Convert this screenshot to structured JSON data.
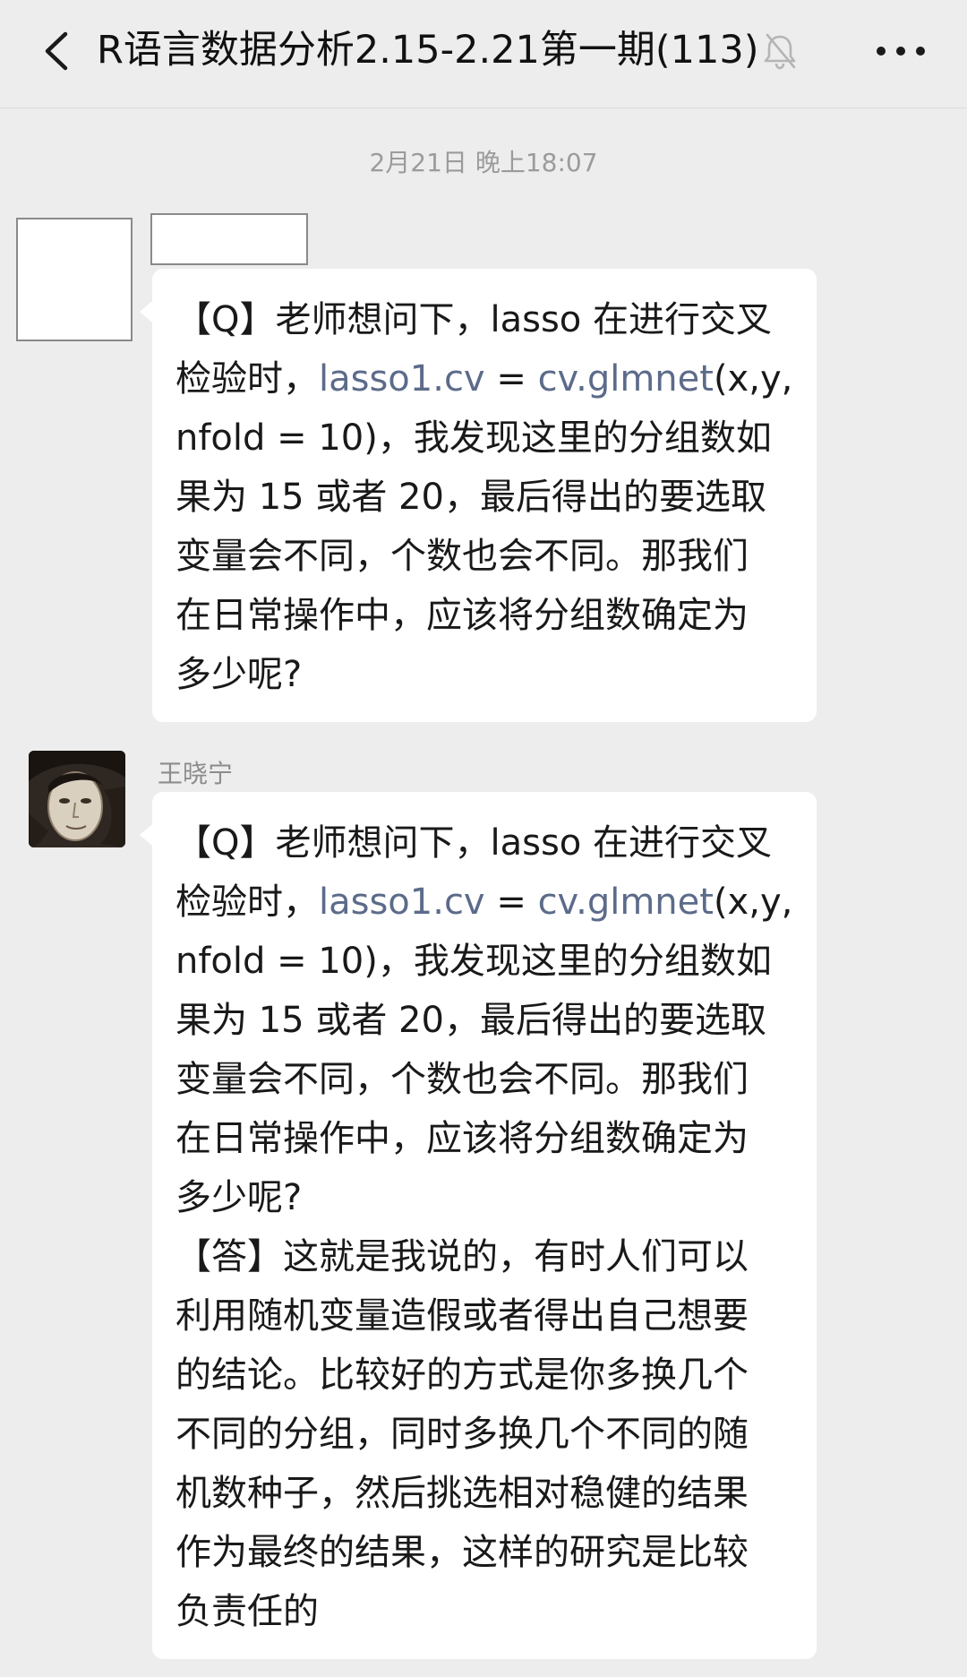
{
  "header": {
    "title": "R语言数据分析2.15-2.21第一期(113)",
    "back_icon": "chevron-left-icon",
    "mute_icon": "bell-off-icon",
    "more_icon": "more-dots-icon"
  },
  "timestamp": "2月21日 晚上18:07",
  "messages": [
    {
      "sender": "",
      "lines": [
        [
          "【Q】老师想问下，lasso 在进行交叉"
        ],
        [
          "检验时，",
          "lasso1.cv",
          " = ",
          "cv.glmnet",
          "(x,y,"
        ],
        [
          "nfold = 10)，我发现这里的分组数如"
        ],
        [
          "果为 15 或者 20，最后得出的要选取"
        ],
        [
          "变量会不同，个数也会不同。那我们"
        ],
        [
          "在日常操作中，应该将分组数确定为"
        ],
        [
          "多少呢?"
        ]
      ]
    },
    {
      "sender": "王晓宁",
      "lines": [
        [
          "【Q】老师想问下，lasso 在进行交叉"
        ],
        [
          "检验时，",
          "lasso1.cv",
          " = ",
          "cv.glmnet",
          "(x,y,"
        ],
        [
          "nfold = 10)，我发现这里的分组数如"
        ],
        [
          "果为 15 或者 20，最后得出的要选取"
        ],
        [
          "变量会不同，个数也会不同。那我们"
        ],
        [
          "在日常操作中，应该将分组数确定为"
        ],
        [
          "多少呢?"
        ],
        [
          "【答】这就是我说的，有时人们可以"
        ],
        [
          "利用随机变量造假或者得出自己想要"
        ],
        [
          "的结论。比较好的方式是你多换几个"
        ],
        [
          "不同的分组，同时多换几个不同的随"
        ],
        [
          "机数种子，然后挑选相对稳健的结果"
        ],
        [
          "作为最终的结果，这样的研究是比较"
        ],
        [
          "负责任的"
        ]
      ]
    }
  ]
}
